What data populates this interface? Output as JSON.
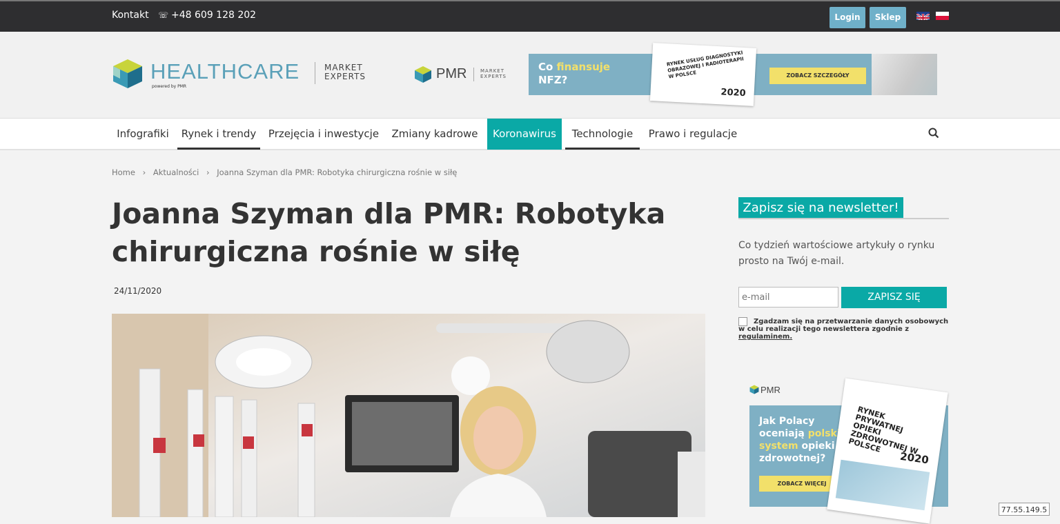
{
  "topbar": {
    "contact_label": "Kontakt",
    "phone": "+48 609 128 202",
    "login_label": "Login",
    "shop_label": "Sklep"
  },
  "logo": {
    "name": "HEALTHCARE",
    "powered": "powered by PMR",
    "market_line1": "MARKET",
    "market_line2": "EXPERTS"
  },
  "pmr_logo": {
    "name": "PMR",
    "market_line1": "MARKET",
    "market_line2": "EXPERTS"
  },
  "banner": {
    "text_before": "Co ",
    "text_highlight": "finansuje",
    "text_after": "NFZ?",
    "report_title": "RYNEK USŁUG DIAGNOSTYKI OBRAZOWEJ I RADIOTERAPII W POLSCE",
    "report_year": "2020",
    "cta": "ZOBACZ SZCZEGÓŁY"
  },
  "nav": {
    "items": [
      "Infografiki",
      "Rynek i trendy",
      "Przejęcia i inwestycje",
      "Zmiany kadrowe",
      "Koronawirus",
      "Technologie",
      "Prawo i regulacje"
    ]
  },
  "breadcrumb": {
    "home": "Home",
    "sep": "›",
    "section": "Aktualności",
    "current": "Joanna Szyman dla PMR: Robotyka chirurgiczna rośnie w siłę"
  },
  "article": {
    "title": "Joanna Szyman dla PMR: Robotyka chirurgiczna rośnie w siłę",
    "date": "24/11/2020"
  },
  "newsletter": {
    "title": "Zapisz się na newsletter!",
    "description": "Co tydzień wartościowe artykuły o rynku prosto na Twój e-mail.",
    "email_placeholder": "e-mail",
    "submit": "ZAPISZ SIĘ",
    "consent_text": "Zgadzam się na przetwarzanie danych osobowych w celu realizacji tego newslettera zgodnie z ",
    "consent_link": "regulaminem."
  },
  "side_ad": {
    "pmr": "PMR",
    "line1": "Jak Polacy",
    "line2_a": "oceniają ",
    "line2_b": "polski",
    "line3_a": "system",
    "line3_b": " opieki",
    "line4": "zdrowotnej?",
    "report_title": "RYNEK PRYWATNEJ OPIEKI ZDROWOTNEJ W POLSCE",
    "report_year": "2020",
    "cta": "ZOBACZ WIĘCEJ"
  },
  "ip_badge": "77.55.149.5",
  "colors": {
    "accent": "#0aa9a6",
    "topbar": "#2e2e30",
    "button_blue": "#6fb0c9",
    "banner_blue": "#7fb0c4",
    "highlight_yellow": "#f2e06a"
  }
}
